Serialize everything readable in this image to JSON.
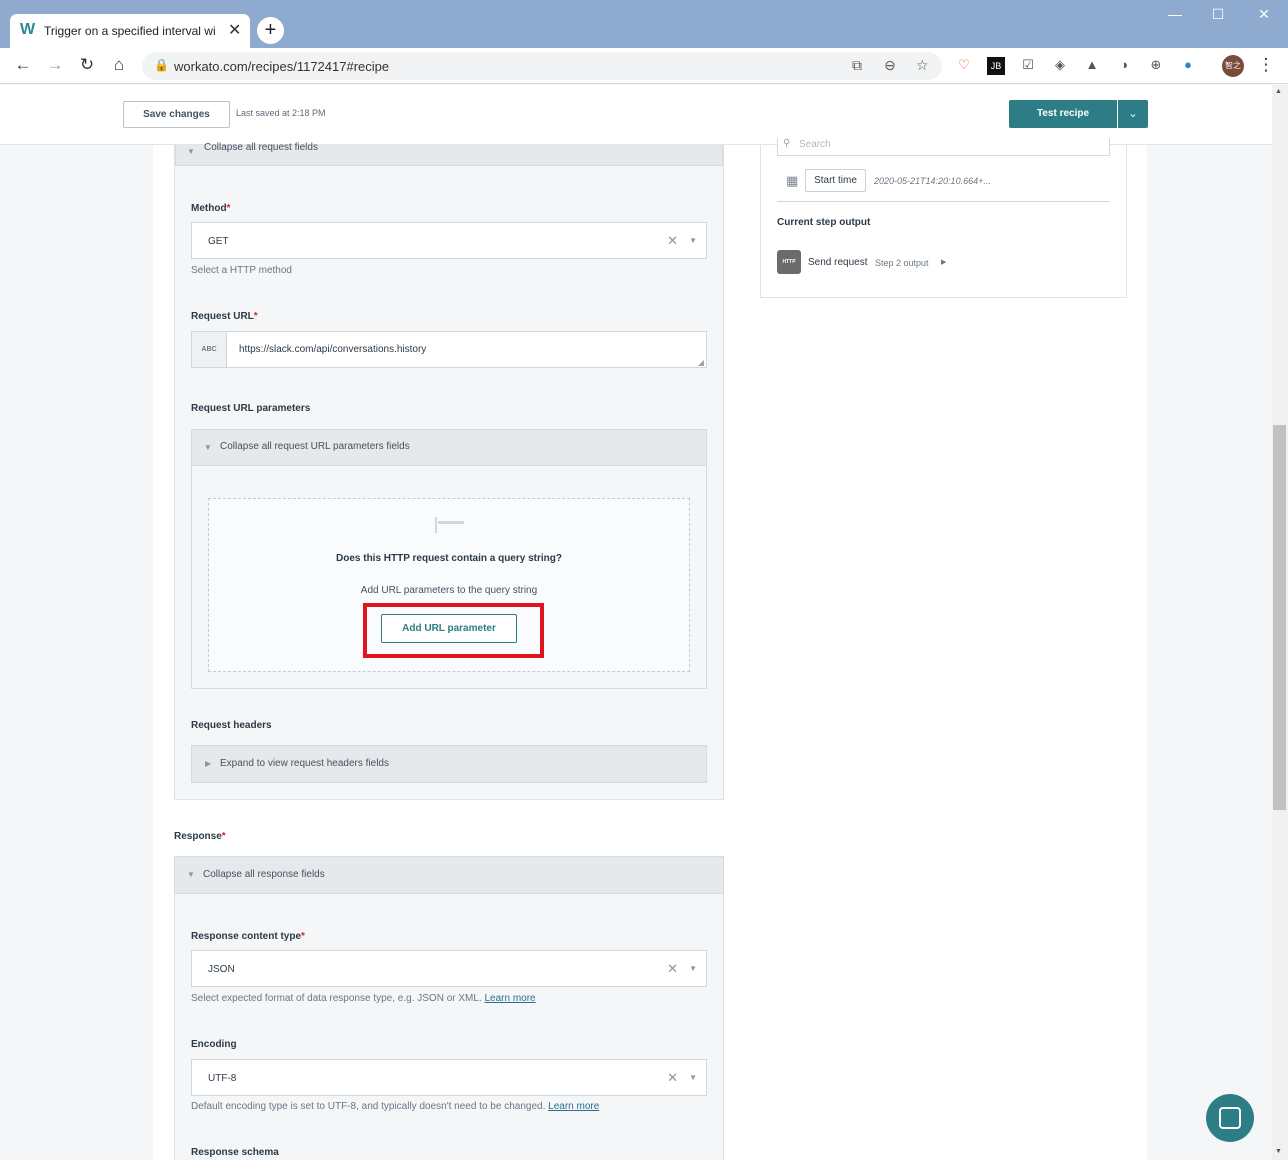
{
  "browser": {
    "tab_title": "Trigger on a specified interval wi",
    "tab_favicon": "W",
    "url": "workato.com/recipes/1172417#recipe",
    "avatar_text": "智之"
  },
  "header": {
    "save_label": "Save changes",
    "last_saved": "Last saved at 2:18 PM",
    "test_label": "Test recipe"
  },
  "request": {
    "collapse_label": "Collapse all request fields",
    "method_label": "Method",
    "method_value": "GET",
    "method_hint": "Select a HTTP method",
    "url_label": "Request URL",
    "url_type": "ABC",
    "url_value": "https://slack.com/api/conversations.history",
    "params_label": "Request URL parameters",
    "params_collapse": "Collapse all request URL parameters fields",
    "empty_title": "Does this HTTP request contain a query string?",
    "empty_sub": "Add URL parameters to the query string",
    "add_param": "Add URL parameter",
    "headers_label": "Request headers",
    "headers_expand": "Expand to view request headers fields"
  },
  "response": {
    "label": "Response",
    "collapse": "Collapse all response fields",
    "content_type_label": "Response content type",
    "content_type_value": "JSON",
    "content_type_hint": "Select expected format of data response type, e.g. JSON or XML.",
    "learn_more": "Learn more",
    "encoding_label": "Encoding",
    "encoding_value": "UTF-8",
    "encoding_hint": "Default encoding type is set to UTF-8, and typically doesn't need to be changed.",
    "schema_label": "Response schema"
  },
  "side_panel": {
    "search_placeholder": "Search",
    "start_time_label": "Start time",
    "start_time_value": "2020-05-21T14:20:10.664+...",
    "current_output_label": "Current step output",
    "http_badge": "HTTP",
    "step_name": "Send request",
    "step_output": "Step 2 output"
  },
  "colors": {
    "accent": "#2d7d87",
    "highlight": "#e0141e",
    "titlebar": "#8faacf"
  }
}
